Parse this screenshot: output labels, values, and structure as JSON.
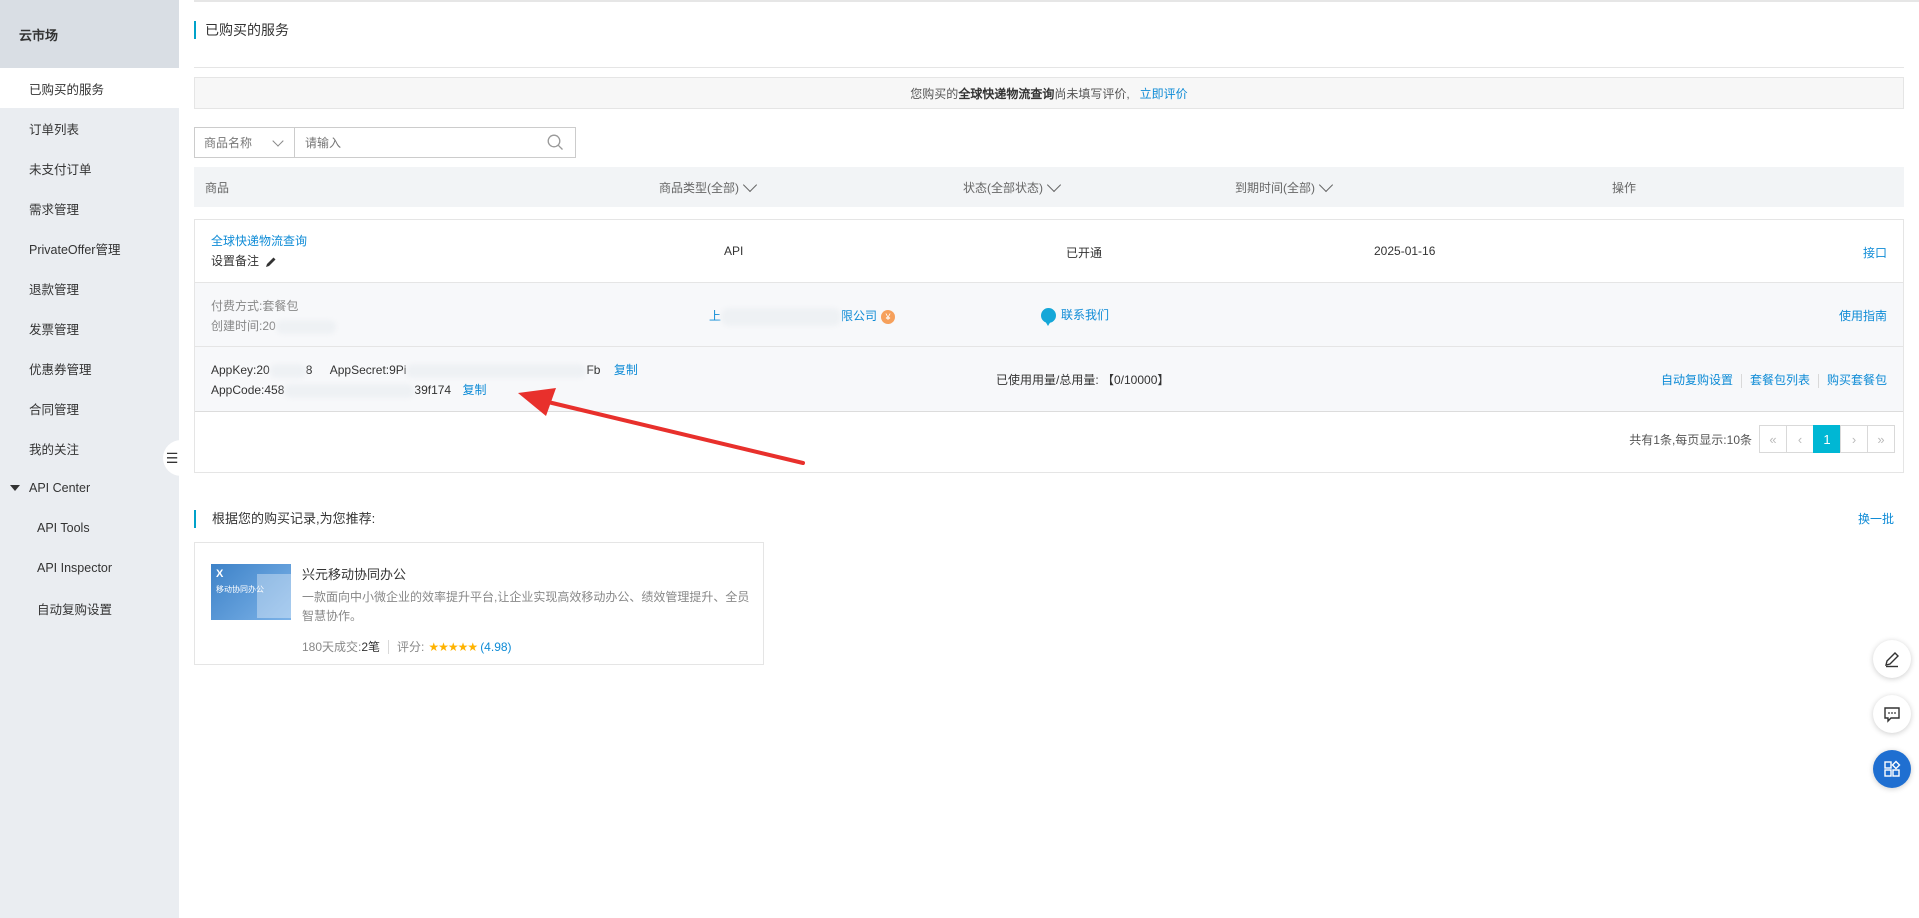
{
  "sidebar": {
    "title": "云市场",
    "items": [
      {
        "label": "已购买的服务"
      },
      {
        "label": "订单列表"
      },
      {
        "label": "未支付订单"
      },
      {
        "label": "需求管理"
      },
      {
        "label": "PrivateOffer管理"
      },
      {
        "label": "退款管理"
      },
      {
        "label": "发票管理"
      },
      {
        "label": "优惠券管理"
      },
      {
        "label": "合同管理"
      },
      {
        "label": "我的关注"
      }
    ],
    "group": {
      "label": "API Center",
      "items": [
        {
          "label": "API Tools"
        },
        {
          "label": "API Inspector"
        },
        {
          "label": "自动复购设置"
        }
      ]
    },
    "collapse_glyph": "☰"
  },
  "page": {
    "title": "已购买的服务"
  },
  "notice": {
    "prefix": "您购买的",
    "product": "全球快递物流查询",
    "suffix": "尚未填写评价,",
    "link": "立即评价"
  },
  "search": {
    "select_label": "商品名称",
    "placeholder": "请输入"
  },
  "table": {
    "headers": {
      "product": "商品",
      "type": "商品类型(全部)",
      "status": "状态(全部状态)",
      "expire": "到期时间(全部)",
      "action": "操作"
    }
  },
  "order": {
    "name": "全球快递物流查询",
    "remark": "设置备注",
    "type": "API",
    "status": "已开通",
    "expire": "2025-01-16",
    "action": "接口",
    "pay_method": "付费方式:套餐包",
    "created": "创建时间:20",
    "vendor_prefix": "上",
    "vendor_suffix": "限公司",
    "contact": "联系我们",
    "guide": "使用指南",
    "appkey_label": "AppKey:20",
    "appkey_end": "8",
    "appsecret_label": "AppSecret:9Pi",
    "appsecret_end": "Fb",
    "copy1": "复制",
    "appcode_label": "AppCode:458",
    "appcode_end": "39f174",
    "copy2": "复制",
    "usage": "已使用用量/总用量: 【0/10000】",
    "actions": [
      "自动复购设置",
      "套餐包列表",
      "购买套餐包"
    ]
  },
  "pager": {
    "summary": "共有1条,每页显示:10条",
    "current": "1",
    "first": "«",
    "prev": "‹",
    "next": "›",
    "last": "»"
  },
  "recommend": {
    "title": "根据您的购买记录,为您推荐:",
    "refresh": "换一批",
    "card": {
      "thumb_mark": "X",
      "thumb_text": "移动协同办公",
      "name": "兴元移动协同办公",
      "desc": "一款面向中小微企业的效率提升平台,让企业实现高效移动办公、绩效管理提升、全员智慧协作。",
      "deals_label": "180天成交:",
      "deals_value": "2笔",
      "rating_label": "评分:",
      "stars": "★★★★★",
      "rating": "(4.98)"
    }
  },
  "colors": {
    "accent": "#00a2ca",
    "link": "#0e8bd6",
    "arrow": "#e8302c",
    "primary_float": "#1f6fd1"
  }
}
